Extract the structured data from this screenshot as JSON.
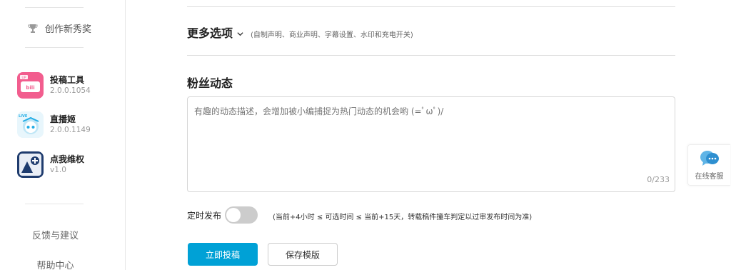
{
  "sidebar": {
    "award_label": "创作新秀奖",
    "tools": [
      {
        "name": "投稿工具",
        "version": "2.0.0.1054",
        "icon": "upload-tool-icon",
        "color": "#f25d8e"
      },
      {
        "name": "直播姬",
        "version": "2.0.0.1149",
        "icon": "live-streamer-icon",
        "color": "#23ade5"
      },
      {
        "name": "点我维权",
        "version": "v1.0",
        "icon": "rights-protection-icon",
        "color": "#1f3c6e"
      }
    ],
    "feedback_label": "反馈与建议",
    "help_label": "帮助中心"
  },
  "main": {
    "more_options": {
      "title": "更多选项",
      "subtitle": "(自制声明、商业声明、字幕设置、水印和充电开关)"
    },
    "fan_dynamic": {
      "title": "粉丝动态",
      "placeholder": "有趣的动态描述，会增加被小编捕捉为热门动态的机会哟 (=ﾟωﾟ)/",
      "value": "",
      "counter": "0/233"
    },
    "schedule": {
      "label": "定时发布",
      "enabled": false,
      "note": "(当前+4小时 ≤ 可选时间 ≤ 当前+15天，转载稿件撞车判定以过审发布时间为准)"
    },
    "submit_label": "立即投稿",
    "save_template_label": "保存模版"
  },
  "service": {
    "label": "在线客服",
    "icon": "chat-bubble-icon"
  },
  "colors": {
    "accent": "#00a1d6",
    "toggle_off": "#cccccc"
  }
}
